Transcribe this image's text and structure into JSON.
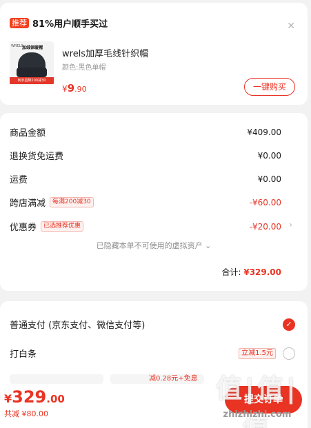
{
  "recommend": {
    "tag": "推荐",
    "title": "81%用户顺手买过",
    "close": "✕",
    "product": {
      "image_brand": "WRELS",
      "image_caption": "加绒保暖帽",
      "image_promo": "到手直降200减30",
      "name": "wrels加厚毛线针织帽",
      "spec": "颜色:黑色单帽",
      "price_symbol": "¥",
      "price_int": "9",
      "price_dec": ".90",
      "buy_label": "一键购买"
    }
  },
  "detail": {
    "rows": [
      {
        "label": "商品金额",
        "value": "¥409.00"
      },
      {
        "label": "退换货免运费",
        "value": "¥0.00"
      },
      {
        "label": "运费",
        "value": "¥0.00"
      },
      {
        "label": "跨店满减",
        "pill": "每满200减30",
        "value": "-¥60.00"
      },
      {
        "label": "优惠券",
        "pill": "已选推荐优惠",
        "value": "-¥20.00"
      }
    ],
    "hidden_note": "已隐藏本单不可使用的虚拟资产 ⌄",
    "total_label": "合计: ",
    "total_value": "¥329.00"
  },
  "payment": {
    "options": [
      {
        "label": "普通支付 (京东支付、微信支付等)",
        "selected": true
      },
      {
        "label": "打白条",
        "discount": "立减1.5元",
        "selected": false
      }
    ],
    "installment_note": "减0.28元+免息"
  },
  "bottom": {
    "price_symbol": "¥",
    "price_int": "329",
    "price_dec": ".00",
    "saved": "共减 ¥80.00",
    "submit_label": "提交订单"
  },
  "watermark": {
    "logo": "值|值|值",
    "url": "zhizhizhi.com"
  },
  "colors": {
    "accent": "#e93323",
    "tag_bg": "#f2401f",
    "page_bg": "#f2f2f2"
  }
}
